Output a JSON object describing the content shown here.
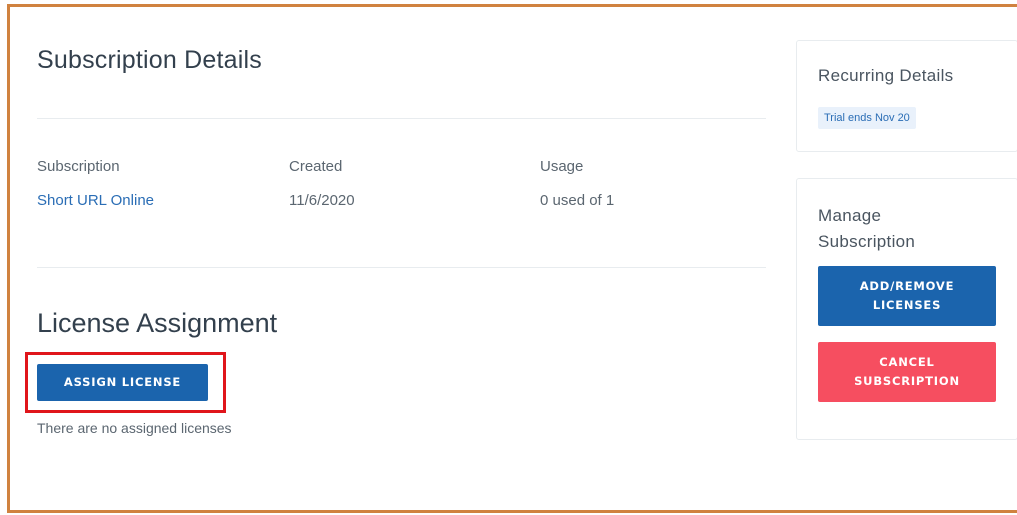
{
  "subscription_details": {
    "title": "Subscription Details",
    "columns": {
      "subscription_label": "Subscription",
      "created_label": "Created",
      "usage_label": "Usage"
    },
    "values": {
      "subscription": "Short URL Online",
      "created": "11/6/2020",
      "usage": "0 used of 1"
    }
  },
  "license_assignment": {
    "title": "License Assignment",
    "assign_button_label": "ASSIGN LICENSE",
    "empty_message": "There are no assigned licenses"
  },
  "recurring_details": {
    "title": "Recurring Details",
    "trial_badge": "Trial ends Nov 20"
  },
  "manage_subscription": {
    "title": "Manage Subscription",
    "add_remove_label": "ADD/REMOVE LICENSES",
    "cancel_label": "CANCEL SUBSCRIPTION"
  },
  "colors": {
    "frame_border": "#d0823f",
    "primary_button": "#1b64ad",
    "danger_button": "#f64e60",
    "link": "#2a6db5",
    "highlight": "#e0151b"
  }
}
